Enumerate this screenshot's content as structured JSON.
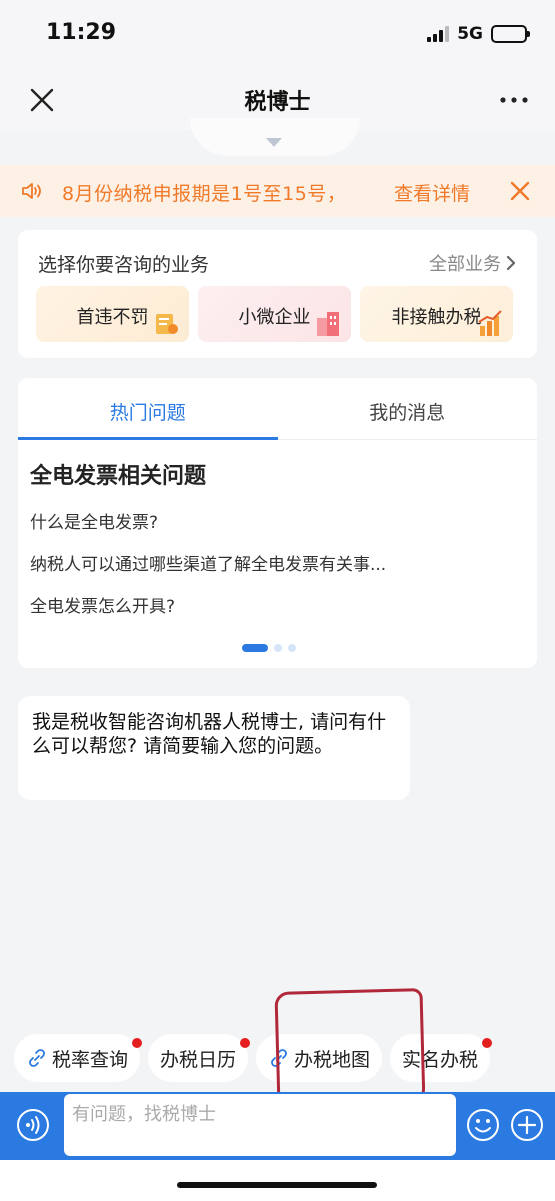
{
  "status_bar": {
    "time": "11:29",
    "network": "5G"
  },
  "nav": {
    "title": "税博士"
  },
  "notice": {
    "text": "8月份纳税申报期是1号至15号，",
    "detail_link": "查看详情"
  },
  "business": {
    "title": "选择你要咨询的业务",
    "all_link": "全部业务",
    "tiles": [
      {
        "label": "首违不罚"
      },
      {
        "label": "小微企业"
      },
      {
        "label": "非接触办税"
      }
    ]
  },
  "hot": {
    "tabs": [
      {
        "label": "热门问题"
      },
      {
        "label": "我的消息"
      }
    ],
    "active_tab": 0,
    "heading": "全电发票相关问题",
    "questions": [
      "什么是全电发票?",
      "纳税人可以通过哪些渠道了解全电发票有关事...",
      "全电发票怎么开具?"
    ],
    "page_count": 3,
    "current_page": 1
  },
  "chat": {
    "bot_message": "我是税收智能咨询机器人税博士, 请问有什么可以帮您? 请简要输入您的问题。"
  },
  "quick_actions": [
    {
      "label": "税率查询",
      "icon": "link-icon",
      "has_dot": true
    },
    {
      "label": "办税日历",
      "icon": "",
      "has_dot": true
    },
    {
      "label": "办税地图",
      "icon": "link-icon",
      "has_dot": false
    },
    {
      "label": "实名办税",
      "icon": "",
      "has_dot": true
    }
  ],
  "input": {
    "placeholder": "有问题，找税博士",
    "value": ""
  },
  "colors": {
    "accent": "#2a7ae2",
    "notice_text": "#f07a2a",
    "notice_bg": "#fdf0e4",
    "badge": "#e41e1e",
    "annotation": "#b0283a"
  }
}
